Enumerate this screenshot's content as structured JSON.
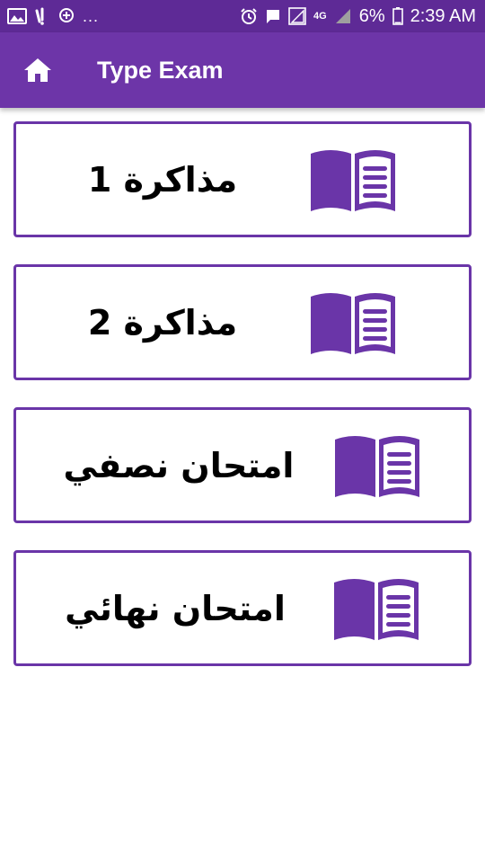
{
  "status_bar": {
    "left_icons": [
      "image-icon",
      "wifi-signal-icon",
      "location-icon"
    ],
    "more": "...",
    "right_icons": [
      "alarm-icon",
      "message-icon",
      "sim-signal-icon",
      "network-4g-icon",
      "signal-icon",
      "battery-icon"
    ],
    "network": "4G",
    "battery": "6%",
    "time": "2:39 AM"
  },
  "app_bar": {
    "home_icon": "home-icon",
    "title": "Type Exam"
  },
  "items": [
    {
      "label": "مذاكرة 1",
      "icon": "book-icon"
    },
    {
      "label": "مذاكرة 2",
      "icon": "book-icon"
    },
    {
      "label": "امتحان نصفي",
      "icon": "book-icon"
    },
    {
      "label": "امتحان نهائي",
      "icon": "book-icon"
    }
  ],
  "colors": {
    "status_bar": "#5e2a96",
    "app_bar": "#6d35a8",
    "accent": "#6a35a8",
    "text": "#000000"
  }
}
